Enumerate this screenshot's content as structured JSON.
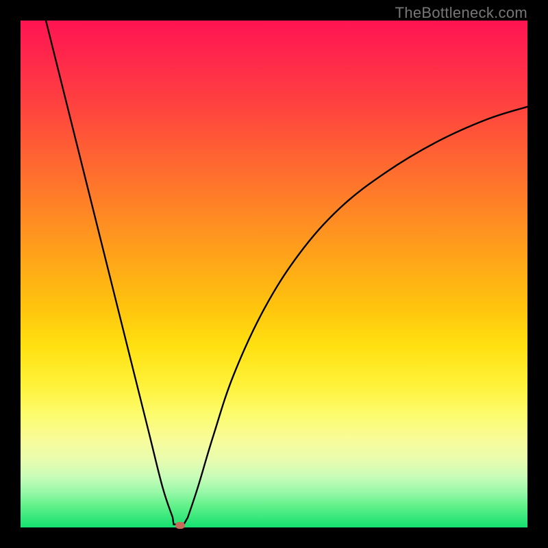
{
  "attribution": "TheBottleneck.com",
  "colors": {
    "frame": "#000000",
    "curve_stroke": "#000000",
    "marker_fill": "#c86a5a",
    "gradient_top": "#ff1452",
    "gradient_bottom": "#14e070"
  },
  "chart_data": {
    "type": "line",
    "title": "",
    "xlabel": "",
    "ylabel": "",
    "xlim": [
      0,
      100
    ],
    "ylim": [
      0,
      100
    ],
    "grid": false,
    "legend": false,
    "annotations": [],
    "series": [
      {
        "name": "bottleneck-curve",
        "x": [
          5,
          10,
          15,
          20,
          25,
          28,
          30,
          31,
          32,
          33,
          35,
          38,
          42,
          48,
          55,
          63,
          72,
          82,
          92,
          100
        ],
        "y": [
          100,
          80,
          60,
          40,
          20,
          8,
          2,
          0.5,
          0.5,
          2,
          8,
          18,
          30,
          43,
          54,
          63,
          70,
          76,
          80.5,
          83
        ]
      }
    ],
    "marker": {
      "x": 31.5,
      "y": 0.4
    },
    "flat_bottom": {
      "x_start": 30.2,
      "x_end": 32.2,
      "y": 0.6
    }
  }
}
